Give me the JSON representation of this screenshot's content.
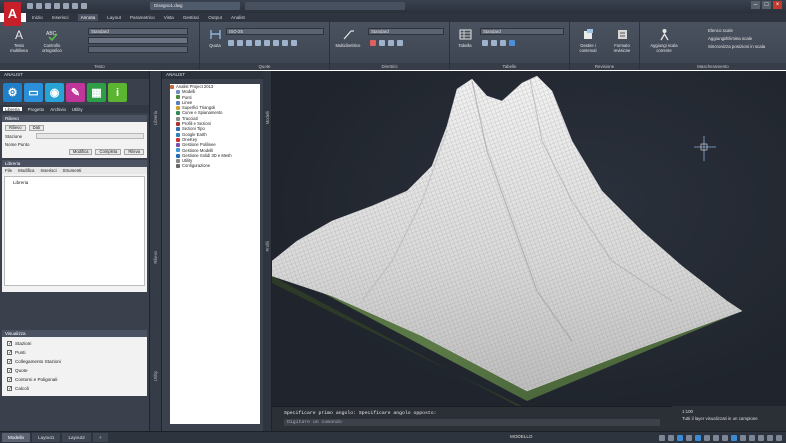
{
  "window": {
    "doc_title": "Disegno1.dwg",
    "controls": [
      "–",
      "□",
      "×"
    ]
  },
  "ribbon_tabs": [
    "Inizio",
    "Inserisci",
    "Annota",
    "Layout",
    "Parametrico",
    "Vista",
    "Gestisci",
    "Output",
    "Analist"
  ],
  "ribbon": {
    "panels": {
      "testo": "Testo",
      "quote": "Quote",
      "direttrici": "Direttrici",
      "tabelle": "Tabelle",
      "revisione": "Revisione",
      "mascheramento": "Mascheramento"
    },
    "text_btn": "Testo multilinea",
    "check_spelling": "Controllo ortografico",
    "text_style": "Standard",
    "dim_btn": "Quota",
    "dim_style": "ISO-25",
    "mleader_btn": "Multidirettrice",
    "mleader_style": "Standard",
    "table_btn": "Tabella",
    "table_style": "Standard",
    "markup_btn": "Gestire i contenuti",
    "markup_btn2": "Formato revisione",
    "annot_btn": "Aggiungi scala corrente",
    "annot_items": [
      "Elenco scale",
      "Aggiungi/Elimina scale",
      "Sincronizza posizioni in scala"
    ]
  },
  "left_palette": {
    "title": "ANALIST",
    "icons": [
      "analist-app",
      "folder",
      "settings",
      "chart",
      "grid",
      "info"
    ],
    "mini_tabs": [
      "Libreria",
      "Progetto",
      "Archivio",
      "Utility"
    ],
    "rilievo": {
      "title": "Rilievo",
      "tabs": [
        "Rilievo",
        "Dati"
      ],
      "stazione_label": "Stazione",
      "nome_punto_label": "Nome Punto",
      "buttons": [
        "Modifica",
        "Completa",
        "Rileva"
      ]
    },
    "libreria": {
      "title": "Libreria",
      "menu": [
        "File",
        "Modifica",
        "Inserisci",
        "Strumenti"
      ],
      "root": "Libreria"
    },
    "visualizza": {
      "title": "Visualizza",
      "items": [
        "Stazioni",
        "Punti",
        "Collegamento Stazioni",
        "Quote",
        "Contorni e Poligonali",
        "Calcoli"
      ]
    }
  },
  "strip_labels": {
    "strip1": [
      "Libreria",
      "Rilievo",
      "Utility"
    ],
    "strip2": [
      "Modelli",
      "Profili"
    ]
  },
  "tree_palette": {
    "title": "ANALIST",
    "items": [
      {
        "label": "Analist Project 2013",
        "color": "#c9683b"
      },
      {
        "label": "Modelli",
        "color": "#6a8fc7"
      },
      {
        "label": "Punti",
        "color": "#4a8a3a"
      },
      {
        "label": "Linee",
        "color": "#5a7fc0"
      },
      {
        "label": "Superfici Triangoli",
        "color": "#d0a030"
      },
      {
        "label": "Curve e Spianamento",
        "color": "#2e8b57"
      },
      {
        "label": "Tracciati",
        "color": "#8a8a8a"
      },
      {
        "label": "Profili e Sezioni",
        "color": "#b03030"
      },
      {
        "label": "Sezioni Tipo",
        "color": "#3070b0"
      },
      {
        "label": "Google Earth",
        "color": "#2d7fc1"
      },
      {
        "label": "OneKey",
        "color": "#cc3333"
      },
      {
        "label": "Gestione Polilinee",
        "color": "#7a4fb0"
      },
      {
        "label": "Gestione Modelli",
        "color": "#3a9ad6"
      },
      {
        "label": "Gestione Solidi 3D e Mesh",
        "color": "#1e6fb8"
      },
      {
        "label": "Utility",
        "color": "#888888"
      },
      {
        "label": "Configurazione",
        "color": "#666666"
      }
    ]
  },
  "viewport": {
    "side_tabs": [
      "Gestione",
      "Parametri",
      "Modello"
    ]
  },
  "command_line": {
    "history": "Specificare primo angolo: Specificare angolo opposto:",
    "input_placeholder": "Digitare un comando"
  },
  "notification": {
    "value": "1:100",
    "message": "Tutti il layer visualizzati in un campione"
  },
  "status_tabs": [
    "Modello",
    "Layout1",
    "Layout2"
  ],
  "status_model_label": "MODELLO"
}
